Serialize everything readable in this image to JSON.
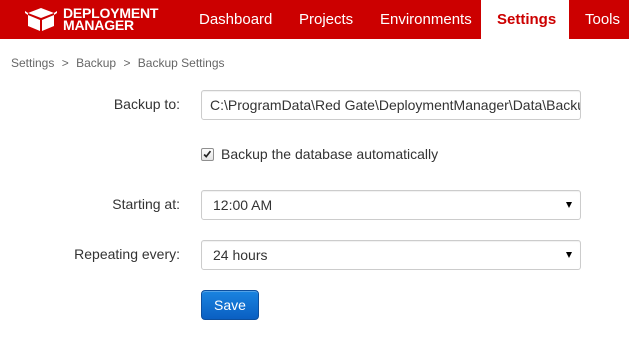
{
  "brand": {
    "line1": "DEPLOYMENT",
    "line2": "MANAGER",
    "color": "#cc0000"
  },
  "nav": {
    "items": [
      {
        "label": "Dashboard"
      },
      {
        "label": "Projects"
      },
      {
        "label": "Environments"
      },
      {
        "label": "Settings",
        "active": true
      },
      {
        "label": "Tools"
      }
    ]
  },
  "breadcrumb": {
    "items": [
      "Settings",
      "Backup",
      "Backup Settings"
    ],
    "separator": ">"
  },
  "form": {
    "backup_to": {
      "label": "Backup to:",
      "value": "C:\\ProgramData\\Red Gate\\DeploymentManager\\Data\\Backups"
    },
    "auto_backup": {
      "label": "Backup the database automatically",
      "checked": true
    },
    "starting_at": {
      "label": "Starting at:",
      "value": "12:00 AM"
    },
    "repeating_every": {
      "label": "Repeating every:",
      "value": "24 hours"
    },
    "save_label": "Save"
  }
}
